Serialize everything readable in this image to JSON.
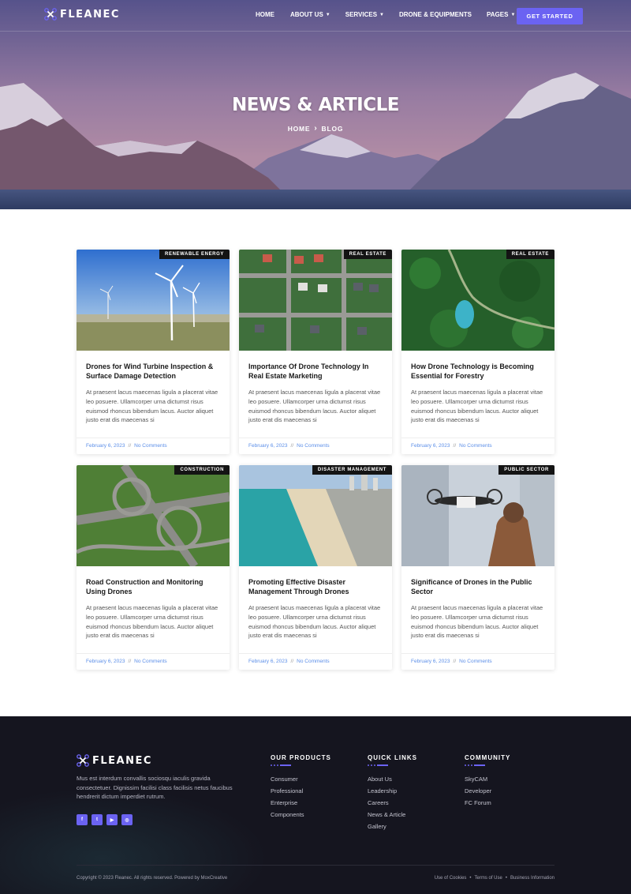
{
  "brand": {
    "name": "FLEANEC",
    "accent": "#6b63f2"
  },
  "nav": {
    "items": [
      {
        "label": "HOME",
        "has_dropdown": false
      },
      {
        "label": "ABOUT US",
        "has_dropdown": true
      },
      {
        "label": "SERVICES",
        "has_dropdown": true
      },
      {
        "label": "DRONE & EQUIPMENTS",
        "has_dropdown": false
      },
      {
        "label": "PAGES",
        "has_dropdown": true
      }
    ],
    "cta": "GET STARTED"
  },
  "hero": {
    "title": "NEWS & ARTICLE",
    "breadcrumb": [
      "HOME",
      "BLOG"
    ]
  },
  "posts": [
    {
      "tag": "RENEWABLE ENERGY",
      "title": "Drones for Wind Turbine Inspection & Surface Damage Detection",
      "excerpt": "At praesent lacus maecenas ligula a placerat vitae leo posuere. Ullamcorper urna dictumst risus euismod rhoncus bibendum lacus. Auctor aliquet justo erat dis maecenas si",
      "date": "February 6, 2023",
      "comments": "No Comments",
      "image": "wind-turbines"
    },
    {
      "tag": "REAL ESTATE",
      "title": "Importance Of Drone Technology In Real Estate Marketing",
      "excerpt": "At praesent lacus maecenas ligula a placerat vitae leo posuere. Ullamcorper urna dictumst risus euismod rhoncus bibendum lacus. Auctor aliquet justo erat dis maecenas si",
      "date": "February 6, 2023",
      "comments": "No Comments",
      "image": "aerial-neighborhood"
    },
    {
      "tag": "REAL ESTATE",
      "title": "How Drone Technology is Becoming Essential for Forestry",
      "excerpt": "At praesent lacus maecenas ligula a placerat vitae leo posuere. Ullamcorper urna dictumst risus euismod rhoncus bibendum lacus. Auctor aliquet justo erat dis maecenas si",
      "date": "February 6, 2023",
      "comments": "No Comments",
      "image": "forest-lake"
    },
    {
      "tag": "CONSTRUCTION",
      "title": "Road Construction and Monitoring Using Drones",
      "excerpt": "At praesent lacus maecenas ligula a placerat vitae leo posuere. Ullamcorper urna dictumst risus euismod rhoncus bibendum lacus. Auctor aliquet justo erat dis maecenas si",
      "date": "February 6, 2023",
      "comments": "No Comments",
      "image": "highway-interchange"
    },
    {
      "tag": "DISASTER MANAGEMENT",
      "title": "Promoting Effective Disaster Management Through Drones",
      "excerpt": "At praesent lacus maecenas ligula a placerat vitae leo posuere. Ullamcorper urna dictumst risus euismod rhoncus bibendum lacus. Auctor aliquet justo erat dis maecenas si",
      "date": "February 6, 2023",
      "comments": "No Comments",
      "image": "beach-coastline"
    },
    {
      "tag": "PUBLIC SECTOR",
      "title": "Significance of Drones in the Public Sector",
      "excerpt": "At praesent lacus maecenas ligula a placerat vitae leo posuere. Ullamcorper urna dictumst risus euismod rhoncus bibendum lacus. Auctor aliquet justo erat dis maecenas si",
      "date": "February 6, 2023",
      "comments": "No Comments",
      "image": "man-with-drone"
    }
  ],
  "footer": {
    "about": "Mus est interdum convallis sociosqu iaculis gravida consectetuer. Dignissim facilisi class facilisis netus faucibus hendrerit dictum imperdiet rutrum.",
    "socials": [
      "f",
      "t",
      "yt",
      "ig"
    ],
    "columns": [
      {
        "title": "OUR PRODUCTS",
        "links": [
          "Consumer",
          "Professional",
          "Enterprise",
          "Components"
        ]
      },
      {
        "title": "QUICK LINKS",
        "links": [
          "About Us",
          "Leadership",
          "Careers",
          "News & Article",
          "Gallery"
        ]
      },
      {
        "title": "COMMUNITY",
        "links": [
          "SkyCAM",
          "Developer",
          "FC Forum"
        ]
      }
    ],
    "copyright": "Copyright © 2023 Fleanec. All rights reserved. Powered by MoxCreative",
    "legal": [
      "Use of Cookies",
      "Terms of Use",
      "Business Information"
    ]
  }
}
